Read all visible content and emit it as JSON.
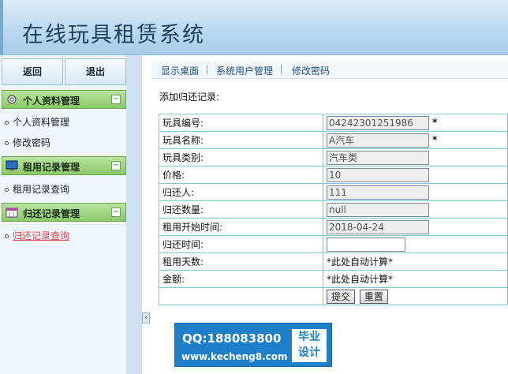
{
  "header": {
    "title": "在线玩具租赁系统"
  },
  "sidebar": {
    "back_label": "返回",
    "logout_label": "退出",
    "groups": [
      {
        "title": "个人资料管理",
        "icon": "gear-icon",
        "items": [
          {
            "label": "个人资料管理"
          },
          {
            "label": "修改密码"
          }
        ]
      },
      {
        "title": "租用记录管理",
        "icon": "monitor-icon",
        "items": [
          {
            "label": "租用记录查询"
          }
        ]
      },
      {
        "title": "归还记录管理",
        "icon": "calendar-icon",
        "items": [
          {
            "label": "归还记录查询",
            "active": true
          }
        ]
      }
    ]
  },
  "nav": {
    "links": [
      "显示桌面",
      "系统用户管理",
      "修改密码"
    ]
  },
  "form": {
    "title": "添加归还记录:",
    "rows": [
      {
        "label": "玩具编号:",
        "value": "04242301251986",
        "required": "*"
      },
      {
        "label": "玩具名称:",
        "value": "A汽车",
        "required": "*"
      },
      {
        "label": "玩具类别:",
        "value": "汽车类"
      },
      {
        "label": "价格:",
        "value": "10"
      },
      {
        "label": "归还人:",
        "value": "111"
      },
      {
        "label": "归还数量:",
        "value": "null"
      },
      {
        "label": "租用开始时间:",
        "value": "2018-04-24"
      },
      {
        "label": "归还时间:",
        "value": ""
      },
      {
        "label": "租用天数:",
        "auto_text": "*此处自动计算*"
      },
      {
        "label": "金额:",
        "auto_text": "*此处自动计算*"
      }
    ],
    "submit_label": "提交",
    "reset_label": "重置"
  },
  "watermark": {
    "qq": "QQ:188083800",
    "site": "www.kecheng8.com",
    "badge_line1": "毕业",
    "badge_line2": "设计"
  },
  "colors": {
    "header_bg": "#bcd9ef",
    "menu_head": "#8cc86a",
    "table_border": "#7cc9d3",
    "watermark_bg": "#1e7fc8"
  }
}
